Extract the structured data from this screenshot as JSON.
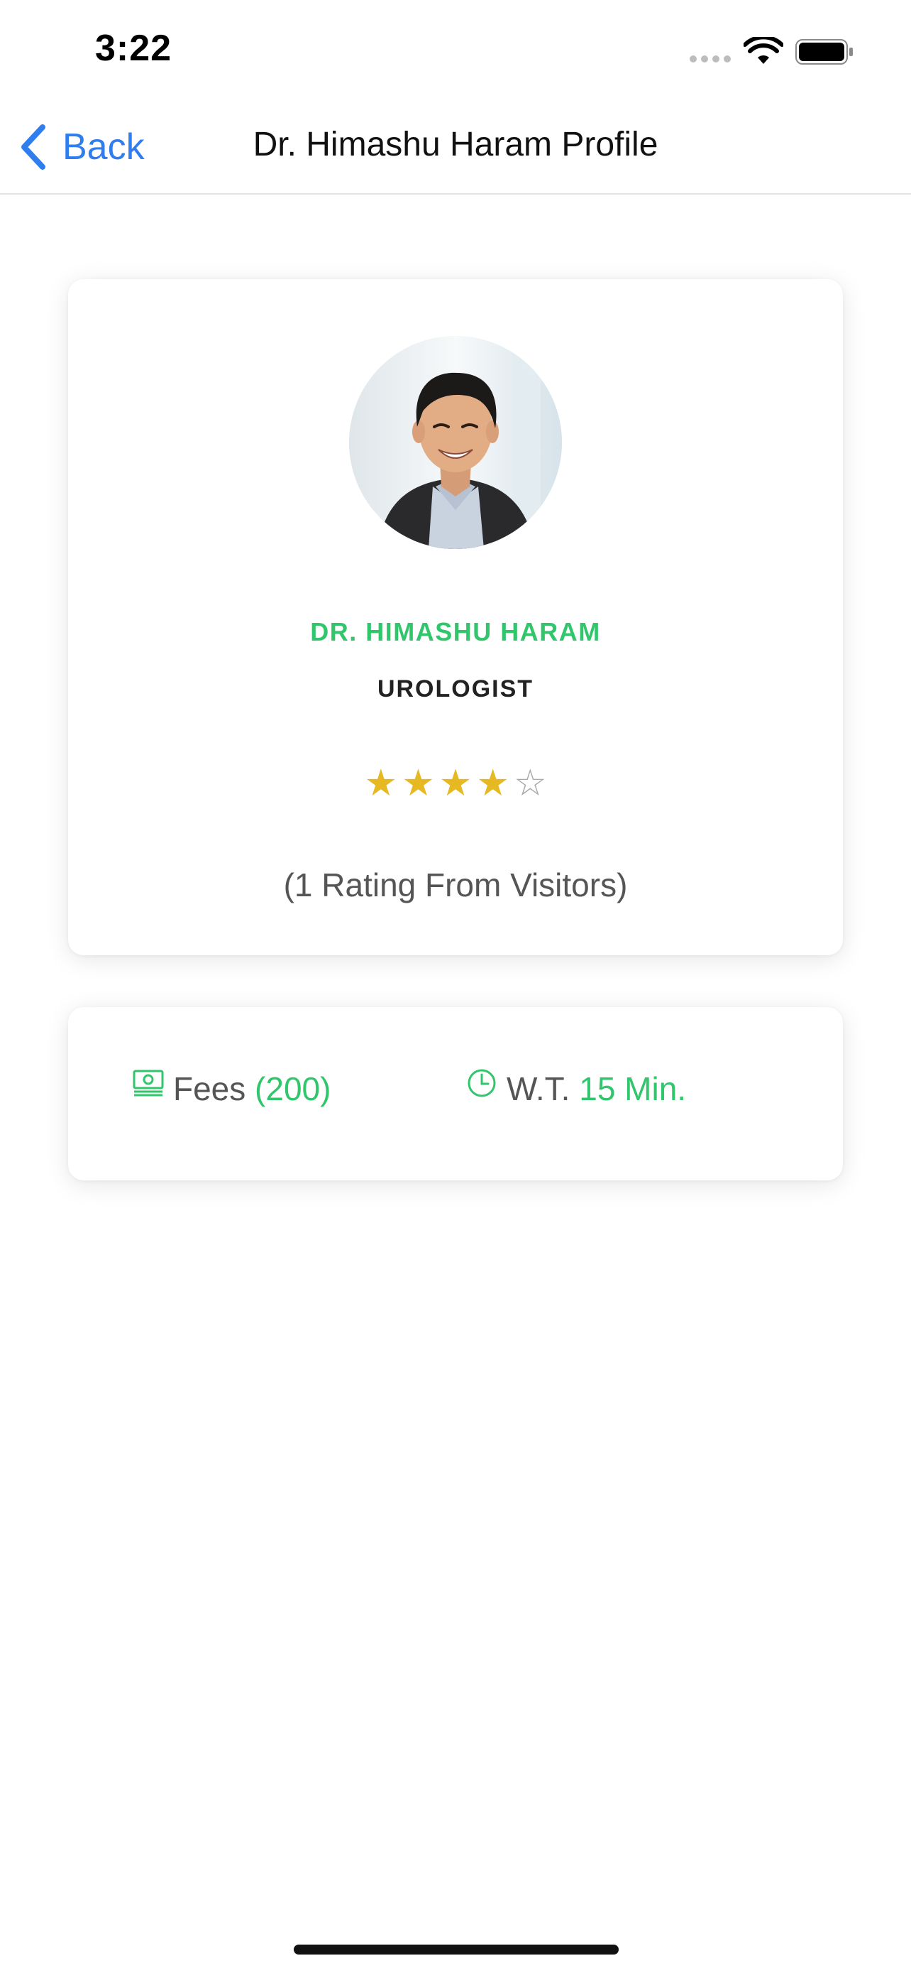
{
  "status_bar": {
    "time": "3:22",
    "signal_icon": "cellular-signal-icon",
    "wifi_icon": "wifi-icon",
    "battery_icon": "battery-icon"
  },
  "nav": {
    "back_label": "Back",
    "back_icon": "chevron-left-icon",
    "title": "Dr. Himashu Haram Profile"
  },
  "profile": {
    "avatar_icon": "doctor-avatar-photo",
    "name": "DR. HIMASHU HARAM",
    "specialty": "UROLOGIST",
    "rating": 4,
    "rating_max": 5,
    "rating_text": "(1 Rating From Visitors)"
  },
  "info": {
    "fees_icon": "money-icon",
    "fees_label": "Fees",
    "fees_value": "(200)",
    "wait_icon": "clock-icon",
    "wait_label": "W.T.",
    "wait_value": "15 Min."
  },
  "colors": {
    "accent_green": "#31c66c",
    "link_blue": "#2f7ef0",
    "star_gold": "#e6b822"
  }
}
